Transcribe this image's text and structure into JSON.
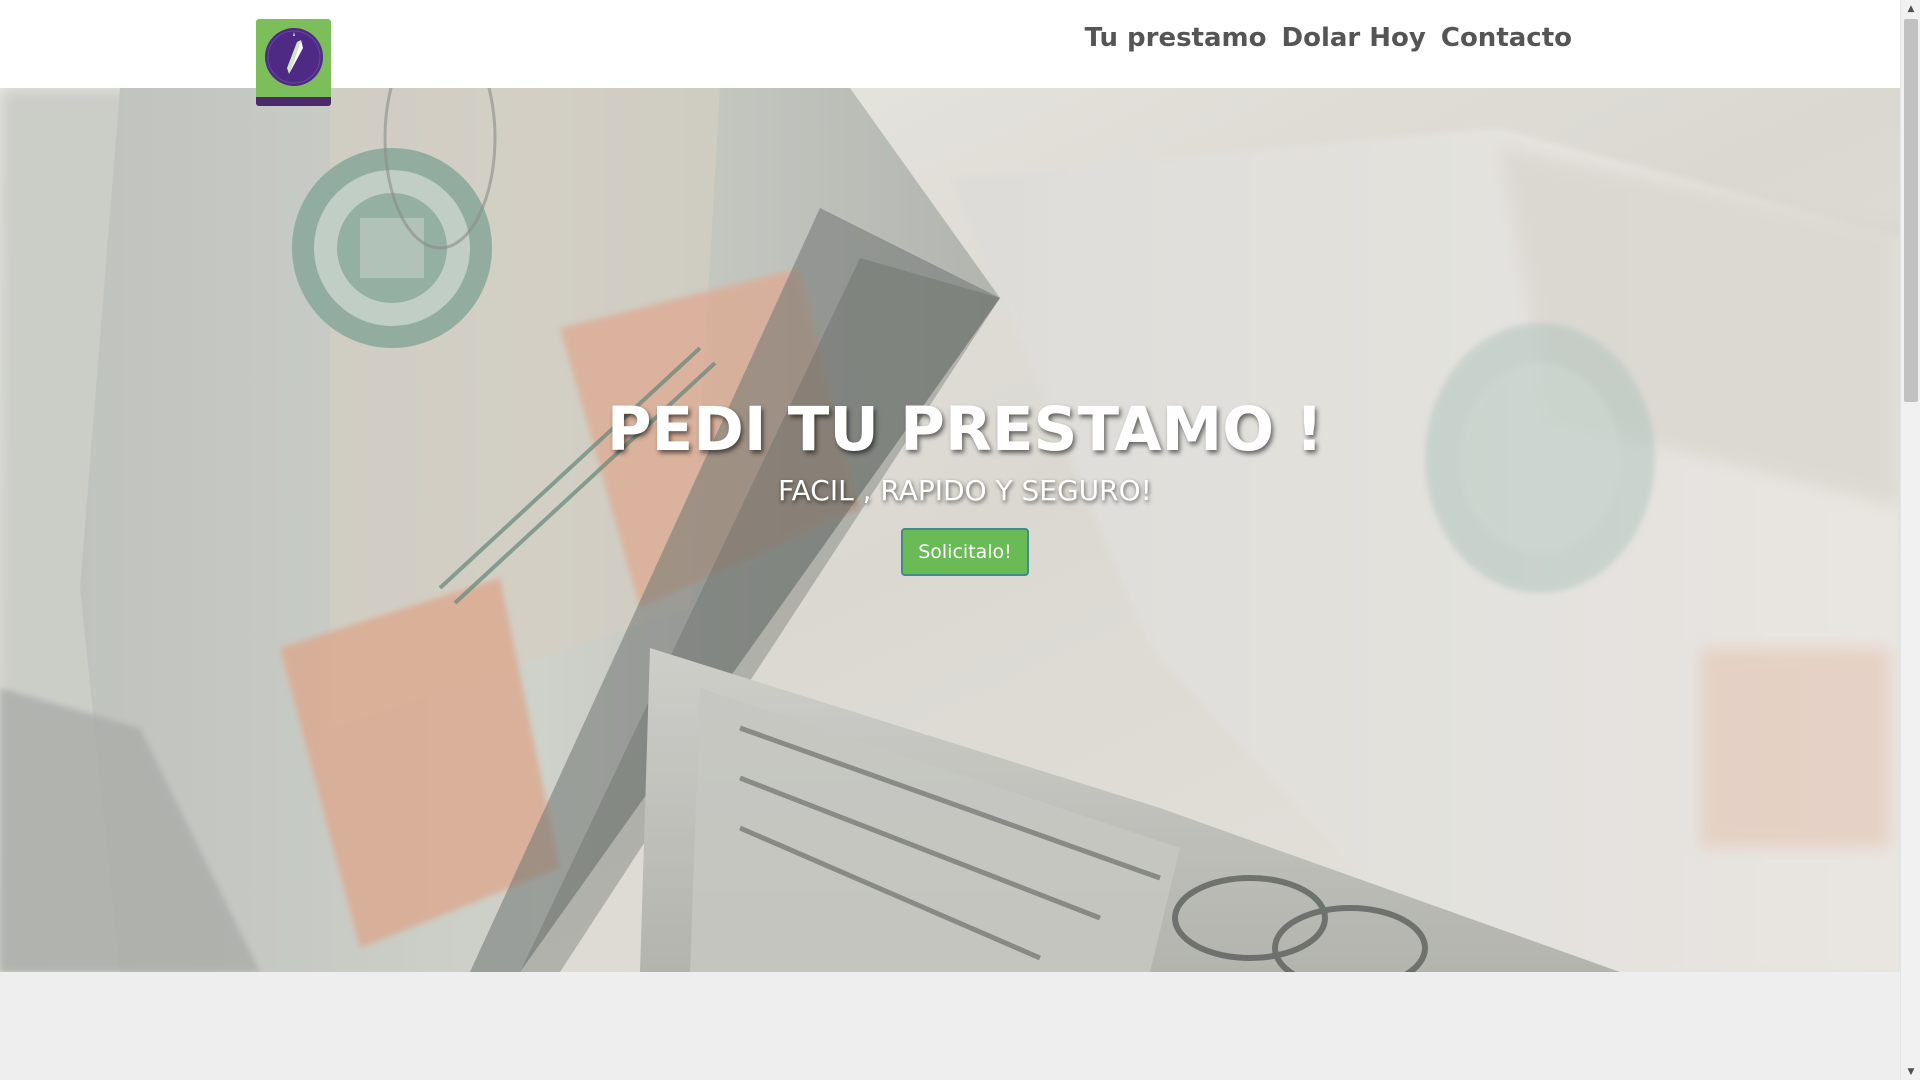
{
  "header": {
    "logo_name": "compass-logo",
    "nav": [
      {
        "label": "Tu prestamo"
      },
      {
        "label": "Dolar Hoy"
      },
      {
        "label": "Contacto"
      }
    ]
  },
  "hero": {
    "title": "PEDI TU PRESTAMO !",
    "subtitle": "FACIL , RAPIDO Y SEGURO!",
    "cta_label": "Solicitalo!"
  },
  "colors": {
    "accent": "#6abb55",
    "logo_bg": "#7cbf5a",
    "logo_circle": "#4e2a85",
    "nav_text": "#555555",
    "page_bg": "#eeeeee"
  },
  "scrollbar": {
    "up_icon": "triangle-up-icon",
    "down_icon": "triangle-down-icon"
  }
}
